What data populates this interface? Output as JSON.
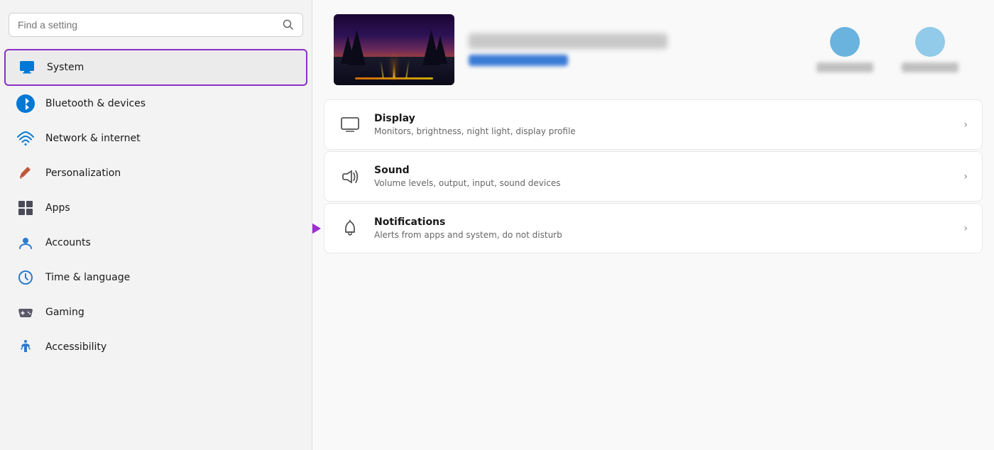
{
  "sidebar": {
    "search": {
      "placeholder": "Find a setting",
      "label": "Find a setting"
    },
    "items": [
      {
        "id": "system",
        "label": "System",
        "icon": "monitor-icon",
        "active": true
      },
      {
        "id": "bluetooth",
        "label": "Bluetooth & devices",
        "icon": "bluetooth-icon",
        "active": false
      },
      {
        "id": "network",
        "label": "Network & internet",
        "icon": "wifi-icon",
        "active": false
      },
      {
        "id": "personalization",
        "label": "Personalization",
        "icon": "brush-icon",
        "active": false
      },
      {
        "id": "apps",
        "label": "Apps",
        "icon": "apps-icon",
        "active": false
      },
      {
        "id": "accounts",
        "label": "Accounts",
        "icon": "accounts-icon",
        "active": false
      },
      {
        "id": "time",
        "label": "Time & language",
        "icon": "clock-icon",
        "active": false
      },
      {
        "id": "gaming",
        "label": "Gaming",
        "icon": "gaming-icon",
        "active": false
      },
      {
        "id": "accessibility",
        "label": "Accessibility",
        "icon": "accessibility-icon",
        "active": false
      }
    ]
  },
  "settings_items": [
    {
      "id": "display",
      "title": "Display",
      "description": "Monitors, brightness, night light, display profile",
      "icon": "display-icon"
    },
    {
      "id": "sound",
      "title": "Sound",
      "description": "Volume levels, output, input, sound devices",
      "icon": "sound-icon"
    },
    {
      "id": "notifications",
      "title": "Notifications",
      "description": "Alerts from apps and system, do not disturb",
      "icon": "notifications-icon"
    }
  ],
  "colors": {
    "accent": "#8b2fc9",
    "active_border": "#8b2fc9",
    "arrow_color": "#9b30d0"
  }
}
